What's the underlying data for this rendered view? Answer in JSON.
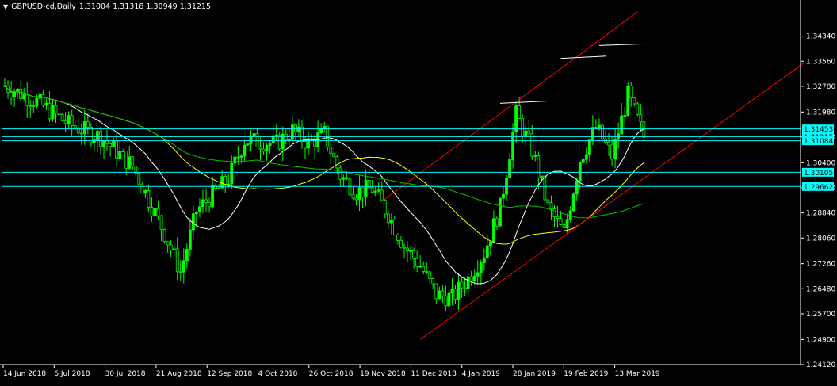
{
  "header": {
    "menu_glyph": "▼",
    "symbol": "GBPUSD-cd,Daily",
    "ohlc": "1.31004 1.31318 1.30949 1.31215"
  },
  "colors": {
    "background": "#000000",
    "bull_candle": "#00ff00",
    "bear_candle": "#00ff00",
    "ma_white": "#ffffff",
    "ma_yellow": "#ffff00",
    "ma_green": "#00c000",
    "channel": "#ff0000",
    "level_line": "#00ffff",
    "level_label_bg": "#00ffff",
    "top_marker": "#ffffff",
    "axis": "#ffffff"
  },
  "chart_data": {
    "type": "candlestick",
    "symbol": "GBPUSD-cd",
    "timeframe": "Daily",
    "ylim": [
      1.2412,
      1.3512
    ],
    "y_ticks": [
      "1.34340",
      "1.33560",
      "1.32780",
      "1.31980",
      "1.31200",
      "1.30400",
      "1.29620",
      "1.28840",
      "1.28060",
      "1.27260",
      "1.26480",
      "1.25700",
      "1.24900",
      "1.24120"
    ],
    "x_ticks": [
      "14 Jun 2018",
      "6 Jul 2018",
      "30 Jul 2018",
      "21 Aug 2018",
      "12 Sep 2018",
      "4 Oct 2018",
      "26 Oct 2018",
      "19 Nov 2018",
      "11 Dec 2018",
      "4 Jan 2019",
      "28 Jan 2019",
      "19 Feb 2019",
      "13 Mar 2019"
    ],
    "bar_count": 200,
    "approx_close_path": [
      [
        0,
        1.328
      ],
      [
        10,
        1.323
      ],
      [
        20,
        1.316
      ],
      [
        30,
        1.312
      ],
      [
        40,
        1.303
      ],
      [
        50,
        1.282
      ],
      [
        55,
        1.27
      ],
      [
        60,
        1.289
      ],
      [
        70,
        1.299
      ],
      [
        75,
        1.311
      ],
      [
        85,
        1.31
      ],
      [
        90,
        1.314
      ],
      [
        95,
        1.31
      ],
      [
        100,
        1.313
      ],
      [
        105,
        1.3
      ],
      [
        110,
        1.295
      ],
      [
        115,
        1.296
      ],
      [
        120,
        1.288
      ],
      [
        125,
        1.278
      ],
      [
        130,
        1.272
      ],
      [
        135,
        1.263
      ],
      [
        140,
        1.262
      ],
      [
        145,
        1.268
      ],
      [
        150,
        1.276
      ],
      [
        155,
        1.29
      ],
      [
        160,
        1.319
      ],
      [
        165,
        1.308
      ],
      [
        170,
        1.29
      ],
      [
        175,
        1.282
      ],
      [
        180,
        1.305
      ],
      [
        185,
        1.315
      ],
      [
        190,
        1.306
      ],
      [
        195,
        1.325
      ],
      [
        200,
        1.3121
      ]
    ],
    "channel_lines": [
      {
        "name": "upper-channel",
        "from": [
          118,
          1.292
        ],
        "to": [
          198,
          1.351
        ]
      },
      {
        "name": "lower-channel",
        "from": [
          130,
          1.249
        ],
        "to": [
          250,
          1.335
        ]
      }
    ],
    "horizontal_levels": [
      {
        "value": 1.31453,
        "label": "1.31453"
      },
      {
        "value": 1.31215,
        "label": "1.31215"
      },
      {
        "value": 1.31084,
        "label": "1.31084"
      },
      {
        "value": 1.30105,
        "label": "1.30105"
      },
      {
        "value": 1.29662,
        "label": "1.29662"
      }
    ],
    "top_markers": [
      {
        "from": [
          155,
          1.3225
        ],
        "to": [
          170,
          1.3232
        ]
      },
      {
        "from": [
          174,
          1.3365
        ],
        "to": [
          188,
          1.3372
        ]
      },
      {
        "from": [
          186,
          1.3405
        ],
        "to": [
          200,
          1.341
        ]
      }
    ],
    "moving_averages": [
      {
        "color": "white",
        "period_hint": "short"
      },
      {
        "color": "yellow",
        "period_hint": "medium"
      },
      {
        "color": "green",
        "period_hint": "long"
      }
    ],
    "grid": false
  }
}
